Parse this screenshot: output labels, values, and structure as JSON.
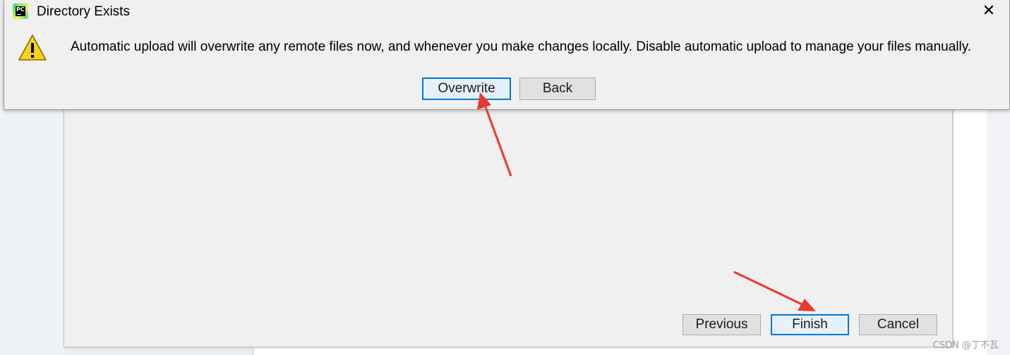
{
  "alert_dialog": {
    "title": "Directory Exists",
    "close_glyph": "✕",
    "app_icon_text": "PC",
    "message": "Automatic upload will overwrite any remote files now, and whenever you make changes locally. Disable automatic upload to manage your files manually.",
    "overwrite_label": "Overwrite",
    "back_label": "Back",
    "icons": {
      "app": "pycharm-logo-icon",
      "warning": "warning-triangle-icon",
      "close": "close-icon"
    }
  },
  "wizard": {
    "previous_label": "Previous",
    "finish_label": "Finish",
    "cancel_label": "Cancel"
  },
  "watermark": "CSDN @丁不瓦",
  "colors": {
    "arrow": "#e8392f",
    "focus_border": "#0078d7",
    "dialog_bg": "#f0f0f0",
    "warning_yellow": "#f7d11e"
  }
}
